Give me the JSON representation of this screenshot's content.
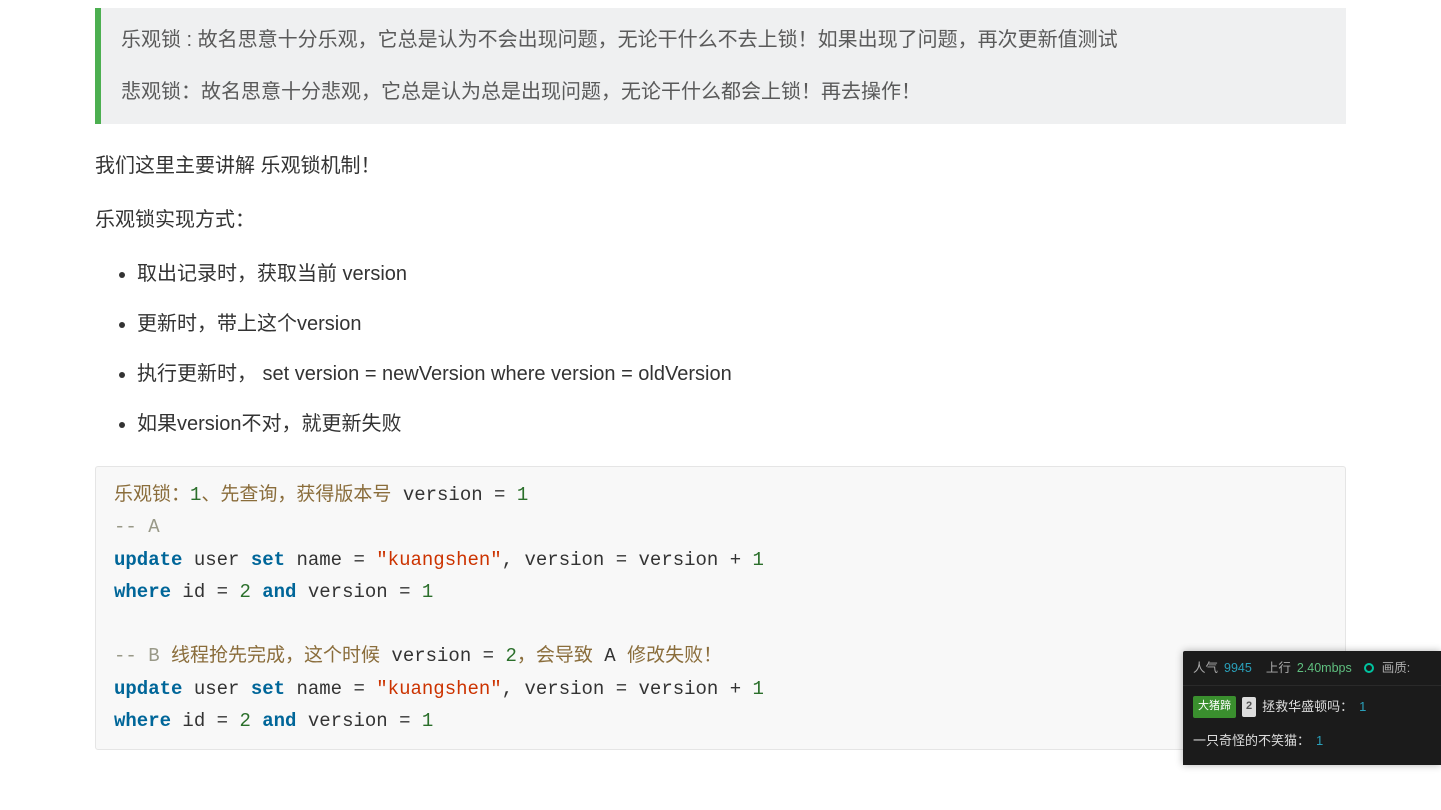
{
  "blockquote": {
    "line1": "乐观锁 : 故名思意十分乐观，它总是认为不会出现问题，无论干什么不去上锁！如果出现了问题，再次更新值测试",
    "line2": "悲观锁：故名思意十分悲观，它总是认为总是出现问题，无论干什么都会上锁！再去操作！"
  },
  "para1": "我们这里主要讲解 乐观锁机制！",
  "para2": "乐观锁实现方式：",
  "points": [
    "取出记录时，获取当前 version",
    "更新时，带上这个version",
    "执行更新时， set version = newVersion where version = oldVersion",
    "如果version不对，就更新失败"
  ],
  "code": {
    "c0_a": "乐观锁：",
    "c0_b": "1",
    "c0_c": "、先查询，获得版本号 ",
    "c0_d": "version",
    "c0_e": " = ",
    "c0_f": "1",
    "c1": "-- A",
    "c2_update": "update",
    "c2_user": " user ",
    "c2_set": "set",
    "c2_name": " name = ",
    "c2_str": "\"kuangshen\"",
    "c2_comma": ", version = version + ",
    "c2_one": "1",
    "c3_where": "where",
    "c3_id": " id = ",
    "c3_two": "2",
    "c3_and": " and ",
    "c3_andkw": "and",
    "c3_ver": " version = ",
    "c3_one": "1",
    "c5_pref": "-- B ",
    "c5_zh1": "线程抢先完成，这个时候 ",
    "c5_ver": "version",
    "c5_eq": " = ",
    "c5_two": "2",
    "c5_zh2": "，会导致 ",
    "c5_a": "A",
    "c5_zh3": " 修改失败！"
  },
  "overlay": {
    "stats": {
      "pop_label": "人气",
      "pop_value": "9945",
      "up_label": "上行",
      "up_value": "2.40mbps",
      "q_label": "画质:"
    },
    "chat": [
      {
        "tag": "大猪蹄",
        "level": "2",
        "name": "拯救华盛顿吗：",
        "msg": "1"
      },
      {
        "name": "一只奇怪的不笑猫：",
        "msg": "1"
      }
    ]
  }
}
